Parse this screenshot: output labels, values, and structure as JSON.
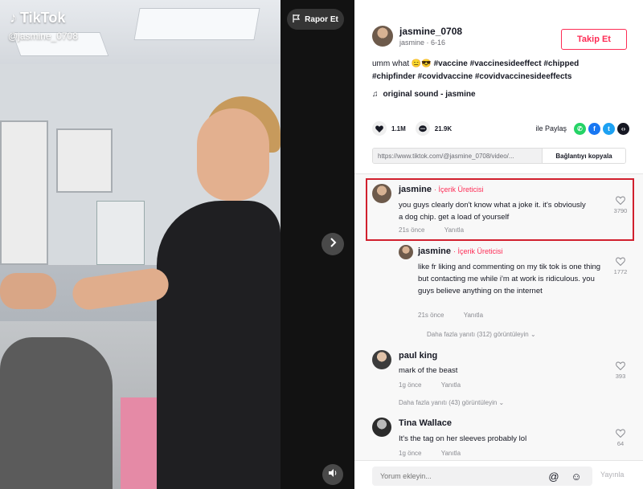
{
  "video": {
    "brand": "TikTok",
    "handle": "@jasmine_0708",
    "report_label": "Rapor Et"
  },
  "author": {
    "name": "jasmine_0708",
    "sub": "jasmine · 6-16",
    "follow_label": "Takip Et"
  },
  "caption": {
    "prefix": "umm what 😑😎",
    "tags": "#vaccine #vaccinesideeffect #chipped #chipfinder #covidvaccine #covidvaccinesideeffects"
  },
  "music": "original sound - jasmine",
  "stats": {
    "likes": "1.1M",
    "comments": "21.9K",
    "share_label": "ile Paylaş"
  },
  "link": {
    "url": "https://www.tiktok.com/@jasmine_0708/video/...",
    "copy_label": "Bağlantıyı kopyala"
  },
  "comments": [
    {
      "name": "jasmine",
      "creator_tag": "· İçerik Üreticisi",
      "text": "you guys clearly don't know what a joke it. it's obviously a dog chip. get a load of yourself",
      "time": "21s önce",
      "reply": "Yanıtla",
      "likes": "3790"
    },
    {
      "name": "jasmine",
      "creator_tag": "· İçerik Üreticisi",
      "text": "like fr liking and commenting on my tik tok is one thing but contacting me while i'm at work is ridiculous. you guys believe anything on the internet",
      "time": "21s önce",
      "reply": "Yanıtla",
      "likes": "1772"
    },
    {
      "name": "paul king",
      "text": "mark of the beast",
      "time": "1g önce",
      "reply": "Yanıtla",
      "likes": "393"
    },
    {
      "name": "Tina Wallace",
      "text": "It's the tag on her sleeves probably lol",
      "time": "1g önce",
      "reply": "Yanıtla",
      "likes": "64"
    }
  ],
  "more_replies": [
    "Daha fazla yanıtı (312) görüntüleyin",
    "Daha fazla yanıtı (43) görüntüleyin"
  ],
  "comment_bar": {
    "placeholder": "Yorum ekleyin...",
    "post_label": "Yayınla"
  },
  "colors": {
    "accent": "#fe2c55",
    "highlight": "#d1202e"
  }
}
